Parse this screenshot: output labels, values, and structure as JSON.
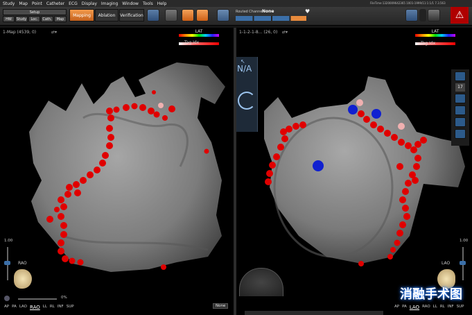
{
  "menu": [
    "Study",
    "Map",
    "Point",
    "Catheter",
    "ECG",
    "Display",
    "Imaging",
    "Window",
    "Tools",
    "Help"
  ],
  "toolbar": {
    "setup": "Setup",
    "sub_buttons": [
      "HW",
      "Study",
      "Loc.",
      "Cath.",
      "Map"
    ],
    "modes": [
      {
        "label": "Mapping",
        "active": true
      },
      {
        "label": "Ablation",
        "active": false
      },
      {
        "label": "Verification",
        "active": false
      }
    ],
    "routed_channel_label": "Routed Channel",
    "routed_channel_value": "None",
    "file_time": "FileTime:1320009642365 1001-1999/11:1:1/1 7.3.563"
  },
  "left_panel": {
    "header": "1-Map (4539, 0)",
    "legend_lat": "LAT",
    "legend_tag": "Tag.Idx",
    "scale_value": "1.00",
    "view_name": "RAO",
    "opacity": "0%",
    "views": [
      "AP",
      "PA",
      "LAO",
      "RAO",
      "LL",
      "RL",
      "INF",
      "SUP"
    ],
    "dropdown": "None"
  },
  "right_panel": {
    "header": "1-1-2-1-8... (26, 0)",
    "legend_lat": "LAT",
    "legend_tag": "Tag.Idx",
    "na_label": "N/A",
    "scale_value": "1.00",
    "view_name": "LAO",
    "views": [
      "AP",
      "PA",
      "LAO",
      "RAO",
      "LL",
      "RL",
      "INF",
      "SUP"
    ],
    "side_number": "17"
  },
  "watermark": "消融手术图",
  "colors": {
    "accent": "#e88a3c",
    "ablation_dot": "#e00000",
    "ref_dot": "#1020d0",
    "mesh": "#8a8a8a"
  }
}
